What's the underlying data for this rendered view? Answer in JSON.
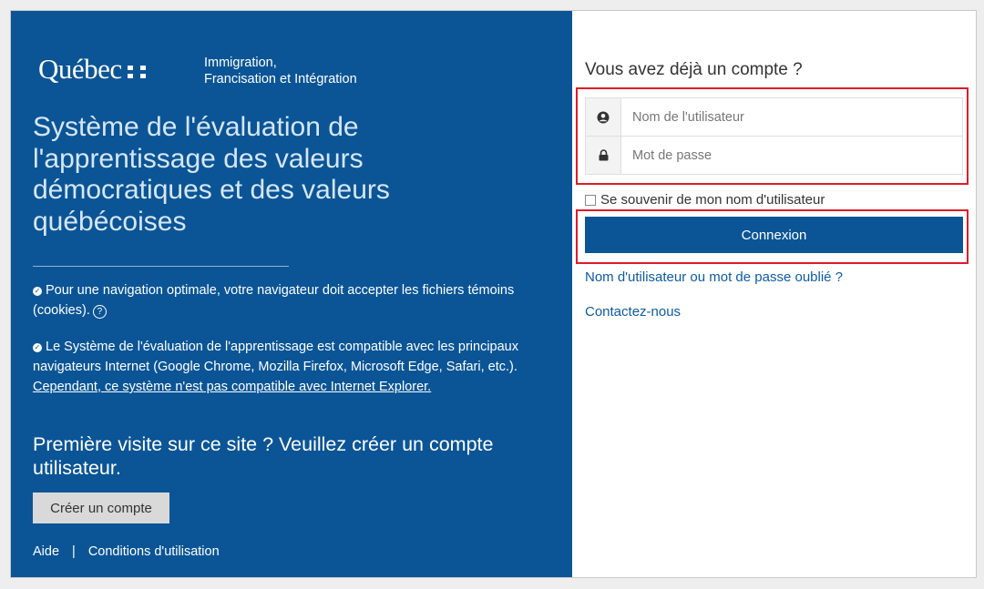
{
  "brand": {
    "logo_text": "Québec",
    "ministry_line1": "Immigration,",
    "ministry_line2": "Francisation et Intégration"
  },
  "left_panel": {
    "title": "Système de l'évaluation de l'apprentissage des valeurs démocratiques et des valeurs québécoises",
    "note1_text": "Pour une navigation optimale, votre navigateur doit accepter les fichiers témoins (cookies).",
    "note2_text": "Le Système de l'évaluation de l'apprentissage est compatible avec les principaux navigateurs Internet (Google Chrome, Mozilla Firefox, Microsoft Edge, Safari, etc.). ",
    "note2_link": "Cependant, ce système n'est pas compatible avec Internet Explorer.",
    "first_visit": "Première visite sur ce site ? Veuillez créer un compte utilisateur.",
    "create_account_label": "Créer un compte",
    "footer": {
      "help_label": "Aide",
      "separator": "|",
      "terms_label": "Conditions d'utilisation"
    }
  },
  "login": {
    "heading": "Vous avez déjà un compte ?",
    "username_placeholder": "Nom de l'utilisateur",
    "password_placeholder": "Mot de passe",
    "remember_label": "Se souvenir de mon nom d'utilisateur",
    "submit_label": "Connexion",
    "forgot_link": "Nom d'utilisateur ou mot de passe oublié ?",
    "contact_link": "Contactez-nous"
  },
  "colors": {
    "brand_blue": "#0b5596",
    "highlight_red": "#e01b2a",
    "link_blue": "#0e5ba8"
  },
  "icons": {
    "check": "check-circle-icon",
    "help": "question-circle-icon",
    "user": "user-circle-icon",
    "lock": "lock-icon"
  }
}
